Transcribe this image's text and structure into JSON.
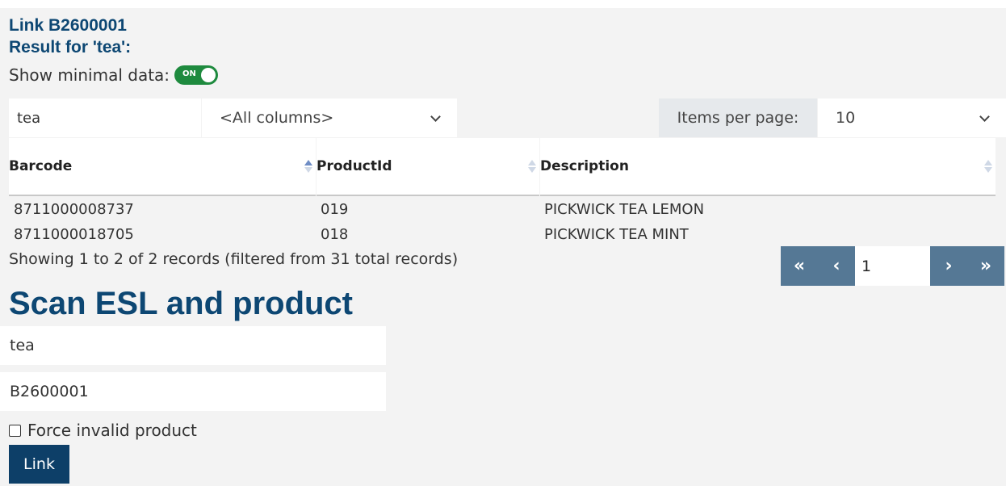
{
  "header": {
    "link_title": "Link B2600001",
    "result_title": "Result for 'tea':",
    "minimal_label": "Show minimal data:",
    "toggle_text": "ON",
    "toggle_color": "#1e8a3e"
  },
  "filter": {
    "search_value": "tea",
    "column_select": "<All columns>",
    "items_per_page_label": "Items per page:",
    "items_per_page_value": "10"
  },
  "table": {
    "headers": [
      "Barcode",
      "ProductId",
      "Description"
    ],
    "rows": [
      [
        "8711000008737",
        "019",
        "PICKWICK TEA LEMON"
      ],
      [
        "8711000018705",
        "018",
        "PICKWICK TEA MINT"
      ]
    ],
    "info": "Showing 1 to 2 of 2 records (filtered from 31 total records)"
  },
  "pager": {
    "first": "«",
    "prev": "‹",
    "page": "1",
    "next": "›",
    "last": "»"
  },
  "scan": {
    "title": "Scan ESL and product",
    "product_value": "tea",
    "esl_value": "B2600001",
    "force_label": "Force invalid product",
    "link_label": "Link"
  },
  "colors": {
    "brand": "#0d4773",
    "pager": "#557895",
    "button": "#0d3f68"
  }
}
